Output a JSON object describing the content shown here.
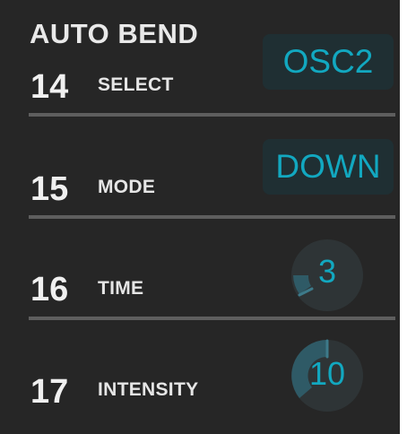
{
  "section": {
    "title": "AUTO BEND"
  },
  "rows": [
    {
      "number": "14",
      "label": "SELECT",
      "control": "selector",
      "value": "OSC2"
    },
    {
      "number": "15",
      "label": "MODE",
      "control": "selector",
      "value": "DOWN"
    },
    {
      "number": "16",
      "label": "TIME",
      "control": "knob",
      "value": "3"
    },
    {
      "number": "17",
      "label": "INTENSITY",
      "control": "knob",
      "value": "10"
    }
  ],
  "colors": {
    "panel_background": "#262626",
    "value_accent": "#12a8c0",
    "selector_background": "#1f2f33",
    "knob_track": "#2e3436",
    "knob_fill": "#2f5a66",
    "divider": "#5e5e5e"
  }
}
